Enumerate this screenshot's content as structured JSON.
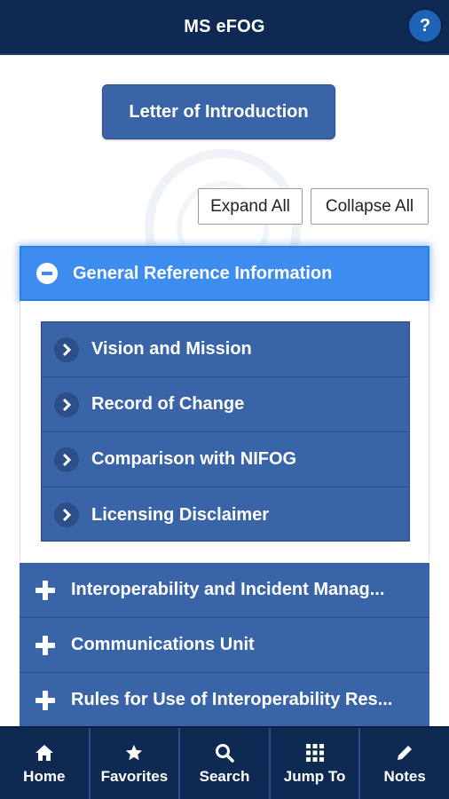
{
  "header": {
    "title": "MS eFOG",
    "help_label": "?"
  },
  "intro": {
    "letter_button": "Letter of Introduction"
  },
  "controls": {
    "expand_all": "Expand All",
    "collapse_all": "Collapse All"
  },
  "sections": [
    {
      "label": "General Reference Information",
      "expanded": true,
      "items": [
        "Vision and Mission",
        "Record of Change",
        "Comparison with NIFOG",
        "Licensing Disclaimer"
      ]
    },
    {
      "label": "Interoperability and Incident Manag...",
      "expanded": false
    },
    {
      "label": "Communications Unit",
      "expanded": false
    },
    {
      "label": "Rules for Use of Interoperability Res...",
      "expanded": false
    }
  ],
  "bottom_nav": [
    {
      "label": "Home",
      "icon": "home-icon"
    },
    {
      "label": "Favorites",
      "icon": "star-icon"
    },
    {
      "label": "Search",
      "icon": "search-icon"
    },
    {
      "label": "Jump To",
      "icon": "grid-icon"
    },
    {
      "label": "Notes",
      "icon": "pencil-icon"
    }
  ],
  "colors": {
    "header_bg": "#0f2a52",
    "section_bg": "#3a64a8",
    "active_section_bg": "#3d8cf0"
  }
}
